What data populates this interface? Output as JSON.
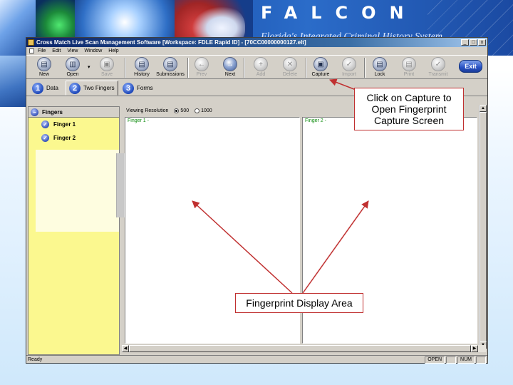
{
  "banner": {
    "title": "FALCON",
    "subtitle": "Florida's Integrated Criminal History System"
  },
  "window": {
    "title": "Cross Match Live Scan Management Software [Workspace: FDLE Rapid ID] - [70CC00000000127.elt]",
    "controls": [
      "_",
      "□",
      "x"
    ],
    "menu": [
      "File",
      "Edit",
      "View",
      "Window",
      "Help"
    ]
  },
  "toolbar": {
    "buttons": [
      {
        "label": "New",
        "icon": "new-document-icon",
        "glyph": "▤"
      },
      {
        "label": "Open",
        "icon": "open-folder-icon",
        "glyph": "▥"
      },
      {
        "label": "Save",
        "icon": "save-icon",
        "glyph": "▣"
      },
      {
        "label": "History",
        "icon": "history-icon",
        "glyph": "▤"
      },
      {
        "label": "Submissions",
        "icon": "submissions-icon",
        "glyph": "▤"
      },
      {
        "label": "Prev",
        "icon": "prev-arrow-icon",
        "glyph": "←"
      },
      {
        "label": "Next",
        "icon": "next-arrow-icon",
        "glyph": "→"
      },
      {
        "label": "Add",
        "icon": "add-icon",
        "glyph": "+"
      },
      {
        "label": "Delete",
        "icon": "delete-icon",
        "glyph": "✕"
      },
      {
        "label": "Capture",
        "icon": "capture-icon",
        "glyph": "▣"
      },
      {
        "label": "Import",
        "icon": "import-icon",
        "glyph": "✓"
      },
      {
        "label": "Lock",
        "icon": "lock-icon",
        "glyph": "▤"
      },
      {
        "label": "Print",
        "icon": "print-icon",
        "glyph": "▤"
      },
      {
        "label": "Transmit",
        "icon": "transmit-icon",
        "glyph": "✓"
      }
    ],
    "exit_label": "Exit",
    "open_caret": "▾"
  },
  "tabs": [
    {
      "num": "1",
      "label": "Data"
    },
    {
      "num": "2",
      "label": "Two Fingers"
    },
    {
      "num": "3",
      "label": "Forms"
    }
  ],
  "sidebar": {
    "header": "Fingers",
    "header_glyph": "−",
    "check_glyph": "✓",
    "items": [
      "Finger 1",
      "Finger 2"
    ]
  },
  "viewer": {
    "resolution_label": "Viewing Resolution",
    "resolution_options": [
      "500",
      "1000"
    ],
    "resolution_selected": "500",
    "panel_labels": [
      "Finger 1 -",
      "Finger 2 -"
    ]
  },
  "scroll_glyphs": {
    "up": "▲",
    "down": "▼",
    "left": "◀",
    "right": "▶"
  },
  "statusbar": {
    "ready": "Ready",
    "indicators": [
      "OPEN",
      "NUM"
    ]
  },
  "callouts": {
    "capture": "Click on Capture to\nOpen Fingerprint\nCapture Screen",
    "display": "Fingerprint Display Area"
  },
  "colors": {
    "callout_border": "#c03030",
    "sidebar_bg": "#fbf88f",
    "banner_bg": "#1c55b0",
    "exit_button": "#2852c4"
  }
}
